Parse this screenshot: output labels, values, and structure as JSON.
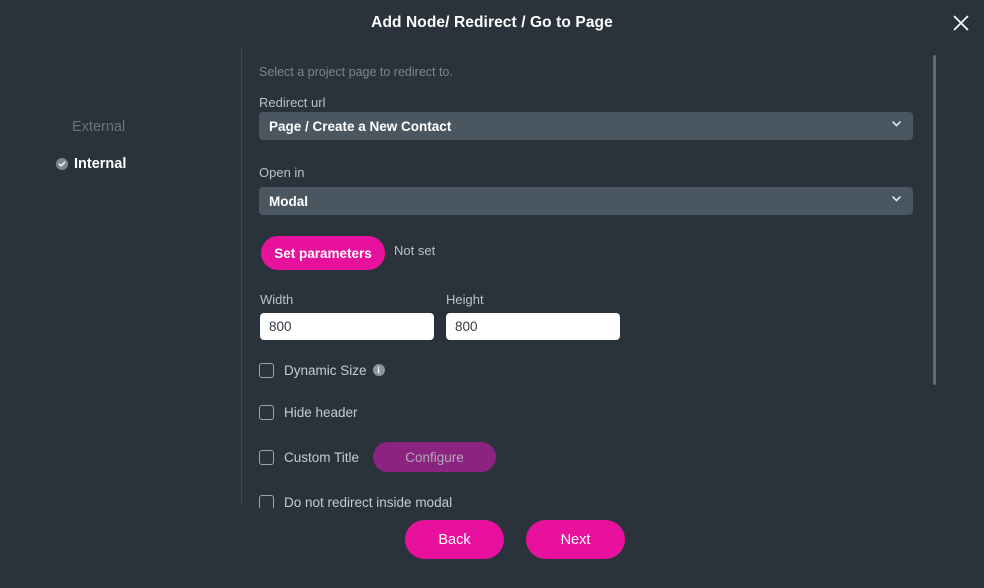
{
  "header": {
    "title": "Add Node/ Redirect / Go to Page",
    "close_icon": "close-icon"
  },
  "sidebar": {
    "items": [
      {
        "label": "External",
        "selected": false
      },
      {
        "label": "Internal",
        "selected": true,
        "icon": "check-circle-icon"
      }
    ]
  },
  "form": {
    "hint": "Select a project page to redirect to.",
    "redirect_url": {
      "label": "Redirect url",
      "value": "Page / Create a New Contact",
      "chevron": "chevron-down-icon"
    },
    "open_in": {
      "label": "Open in",
      "value": "Modal",
      "chevron": "chevron-down-icon"
    },
    "set_parameters": {
      "button_label": "Set parameters",
      "status": "Not set"
    },
    "width": {
      "label": "Width",
      "value": "800"
    },
    "height": {
      "label": "Height",
      "value": "800"
    },
    "checkboxes": [
      {
        "label": "Dynamic Size",
        "checked": false,
        "info": "i"
      },
      {
        "label": "Hide header",
        "checked": false
      },
      {
        "label": "Custom Title",
        "checked": false,
        "action_label": "Configure"
      },
      {
        "label": "Do not redirect inside modal",
        "checked": false
      }
    ]
  },
  "footer": {
    "back_label": "Back",
    "next_label": "Next"
  },
  "colors": {
    "background": "#2a333b",
    "accent_pink": "#e8119e",
    "field_grey": "#4a5760",
    "configure_purple": "#8a2480",
    "input_white": "#ffffff"
  }
}
